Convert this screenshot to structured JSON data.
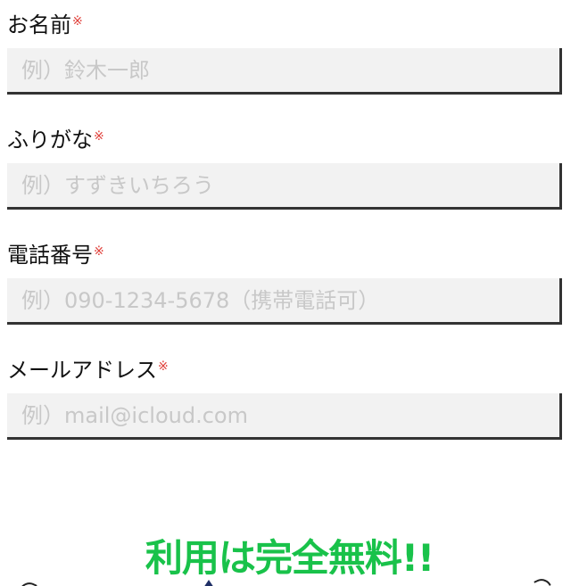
{
  "form": {
    "required_mark": "※",
    "fields": [
      {
        "label": "お名前",
        "placeholder": "例）鈴木一郎",
        "value": ""
      },
      {
        "label": "ふりがな",
        "placeholder": "例）すずきいちろう",
        "value": ""
      },
      {
        "label": "電話番号",
        "placeholder": "例）090-1234-5678（携帯電話可）",
        "value": ""
      },
      {
        "label": "メールアドレス",
        "placeholder": "例）mail@icloud.com",
        "value": ""
      }
    ]
  },
  "promo": {
    "headline": "利用は完全無料!!",
    "headline_color": "#19c24a"
  },
  "colors": {
    "required": "#e0413b",
    "input_bg": "#f2f2f2",
    "input_shadow": "#333333"
  }
}
